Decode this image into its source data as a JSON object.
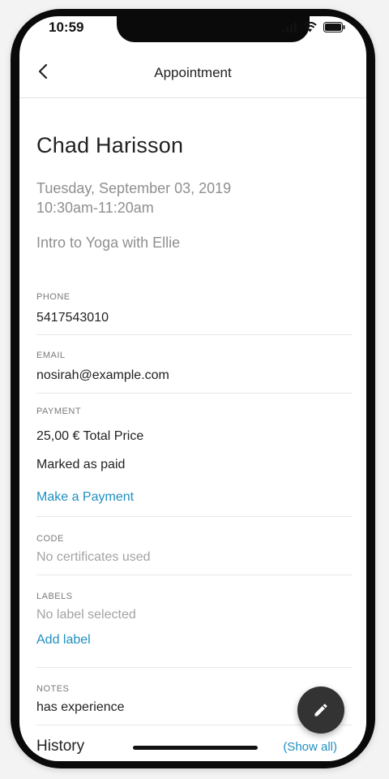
{
  "status_bar": {
    "time": "10:59",
    "icons": [
      "signal-icon",
      "wifi-icon",
      "battery-icon"
    ]
  },
  "navbar": {
    "back_icon": "chevron-left-icon",
    "title": "Appointment"
  },
  "client": {
    "name": "Chad Harisson",
    "date": "Tuesday, September 03, 2019",
    "time_range": "10:30am-11:20am",
    "service": "Intro to Yoga with Ellie"
  },
  "phone": {
    "label": "PHONE",
    "value": "5417543010"
  },
  "email": {
    "label": "EMAIL",
    "value": "nosirah@example.com"
  },
  "payment": {
    "label": "PAYMENT",
    "total": "25,00 € Total Price",
    "status": "Marked as paid",
    "action": "Make a Payment"
  },
  "code": {
    "label": "CODE",
    "value": "No certificates used"
  },
  "labels": {
    "label": "LABELS",
    "value": "No label selected",
    "action": "Add label"
  },
  "notes": {
    "label": "NOTES",
    "value": "has experience"
  },
  "history": {
    "title": "History",
    "show_all": "(Show all)"
  },
  "fab": {
    "icon": "pencil-icon"
  },
  "colors": {
    "accent": "#1f8fc0",
    "fab": "#333333",
    "muted": "#8f8f8f"
  }
}
